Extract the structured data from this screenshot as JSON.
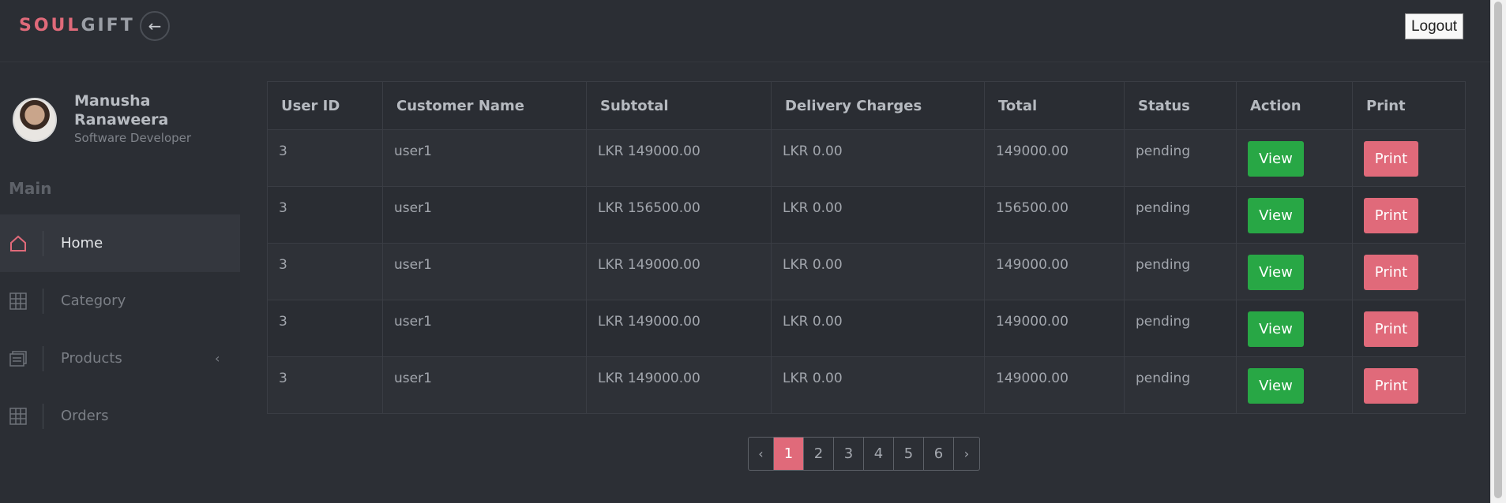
{
  "brand": {
    "part1": "SOUL",
    "part2": "GIFT"
  },
  "header": {
    "back_icon": "arrow-left-icon",
    "logout_label": "Logout"
  },
  "profile": {
    "name": "Manusha Ranaweera",
    "role": "Software Developer"
  },
  "sidebar": {
    "section": "Main",
    "items": [
      {
        "label": "Home",
        "icon": "home-icon",
        "active": true
      },
      {
        "label": "Category",
        "icon": "grid-icon"
      },
      {
        "label": "Products",
        "icon": "layers-icon"
      },
      {
        "label": "Orders",
        "icon": "grid-icon"
      }
    ]
  },
  "table": {
    "headers": [
      "User ID",
      "Customer Name",
      "Subtotal",
      "Delivery Charges",
      "Total",
      "Status",
      "Action",
      "Print"
    ],
    "rows": [
      {
        "user_id": "3",
        "customer": "user1",
        "subtotal": "LKR 149000.00",
        "delivery": "LKR 0.00",
        "total": "149000.00",
        "status": "pending",
        "action": "View",
        "print": "Print"
      },
      {
        "user_id": "3",
        "customer": "user1",
        "subtotal": "LKR 156500.00",
        "delivery": "LKR 0.00",
        "total": "156500.00",
        "status": "pending",
        "action": "View",
        "print": "Print"
      },
      {
        "user_id": "3",
        "customer": "user1",
        "subtotal": "LKR 149000.00",
        "delivery": "LKR 0.00",
        "total": "149000.00",
        "status": "pending",
        "action": "View",
        "print": "Print"
      },
      {
        "user_id": "3",
        "customer": "user1",
        "subtotal": "LKR 149000.00",
        "delivery": "LKR 0.00",
        "total": "149000.00",
        "status": "pending",
        "action": "View",
        "print": "Print"
      },
      {
        "user_id": "3",
        "customer": "user1",
        "subtotal": "LKR 149000.00",
        "delivery": "LKR 0.00",
        "total": "149000.00",
        "status": "pending",
        "action": "View",
        "print": "Print"
      }
    ]
  },
  "pagination": {
    "prev": "‹",
    "pages": [
      "1",
      "2",
      "3",
      "4",
      "5",
      "6"
    ],
    "current": "1",
    "next": "›"
  },
  "colors": {
    "accent": "#e06a7a",
    "success": "#28a745",
    "background": "#2c2f35"
  }
}
